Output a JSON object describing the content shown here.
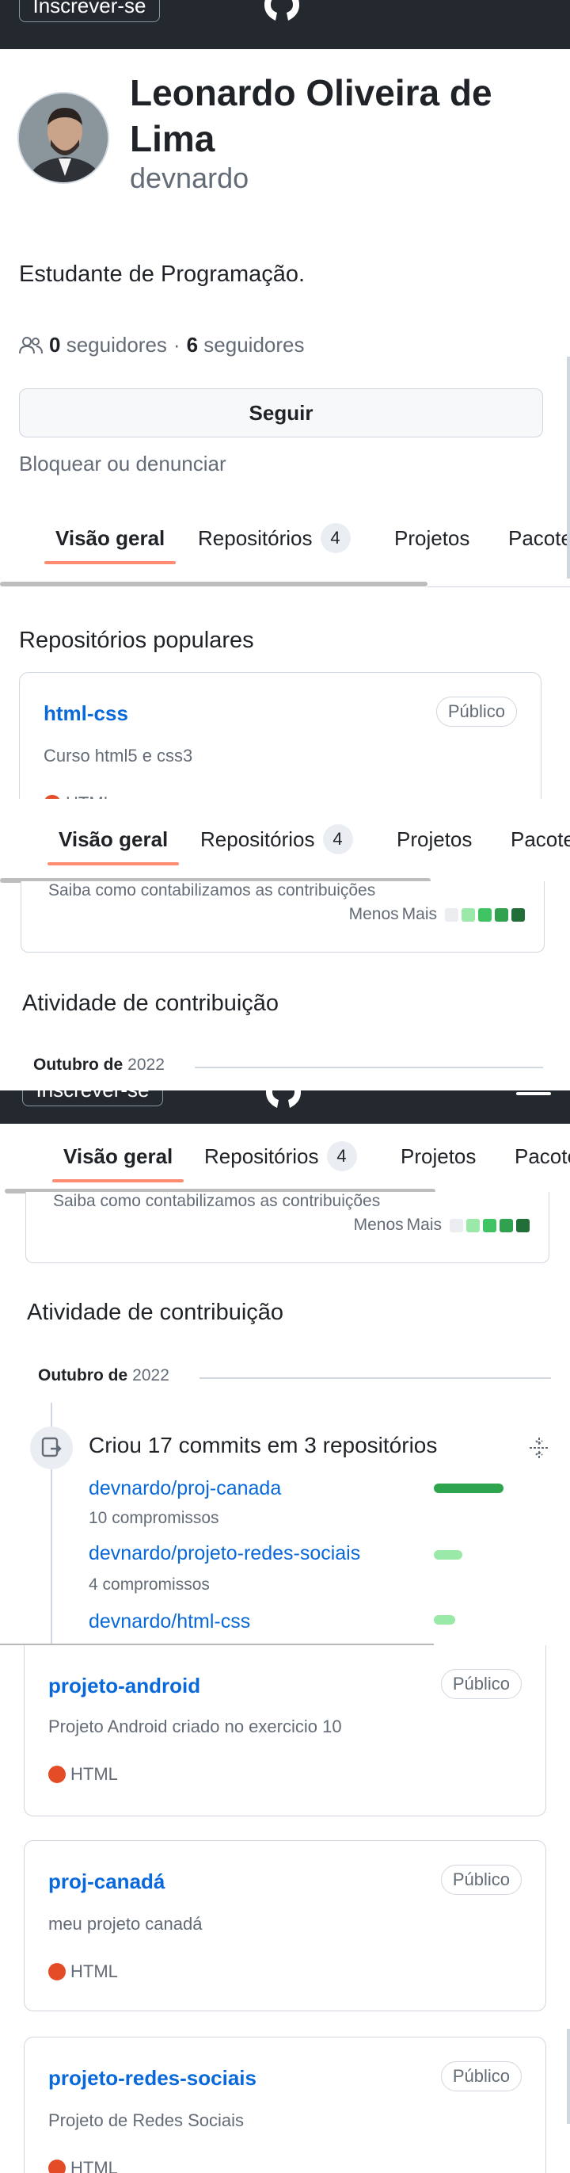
{
  "header": {
    "signup_label": "Inscrever-se",
    "logo_icon": "github-logo-icon",
    "menu_icon": "hamburger-menu-icon"
  },
  "profile": {
    "name": "Leonardo Oliveira de Lima",
    "username": "devnardo",
    "bio": "Estudante de Programação.",
    "followers_count": "0",
    "followers_label": "seguidores",
    "separator": "·",
    "following_count": "6",
    "following_label": "seguidores",
    "follow_button": "Seguir",
    "block_link": "Bloquear ou denunciar"
  },
  "tabs": {
    "overview": "Visão geral",
    "repositories": "Repositórios",
    "repositories_count": "4",
    "projects": "Projetos",
    "packages": "Pacotes"
  },
  "popular": {
    "title": "Repositórios populares",
    "repos": [
      {
        "name": "html-css",
        "visibility": "Público",
        "description": "Curso html5 e css3",
        "language": "HTML"
      },
      {
        "name": "projeto-android",
        "visibility": "Público",
        "description": "Projeto Android criado no exercicio 10",
        "language": "HTML"
      },
      {
        "name": "proj-canadá",
        "visibility": "Público",
        "description": "meu projeto canadá",
        "language": "HTML"
      },
      {
        "name": "projeto-redes-sociais",
        "visibility": "Público",
        "description": "Projeto de Redes Sociais",
        "language": "HTML"
      }
    ]
  },
  "contributions": {
    "learn_link": "Saiba como contabilizamos as contribuições",
    "legend_less": "Menos",
    "legend_more": "Mais",
    "legend_colors": [
      "#ebedf0",
      "#9be9a8",
      "#40c463",
      "#30a14e",
      "#216e39"
    ]
  },
  "activity": {
    "title": "Atividade de contribuição",
    "month": "Outubro de",
    "year": "2022",
    "commits_summary": "Criou 17 commits em 3 repositórios",
    "repos": [
      {
        "name": "devnardo/proj-canada",
        "count": "10 compromissos",
        "share": 0.59
      },
      {
        "name": "devnardo/projeto-redes-sociais",
        "count": "4 compromissos",
        "share": 0.24
      },
      {
        "name": "devnardo/html-css",
        "count": "",
        "share": 0.18
      }
    ]
  },
  "colors": {
    "accent_link": "#0969da",
    "tab_underline": "#fd8c73",
    "header_bg": "#24292f",
    "html_lang": "#e34c26",
    "activity_bar_dark": "#2da44e",
    "activity_bar_light": "#9be9a8"
  }
}
